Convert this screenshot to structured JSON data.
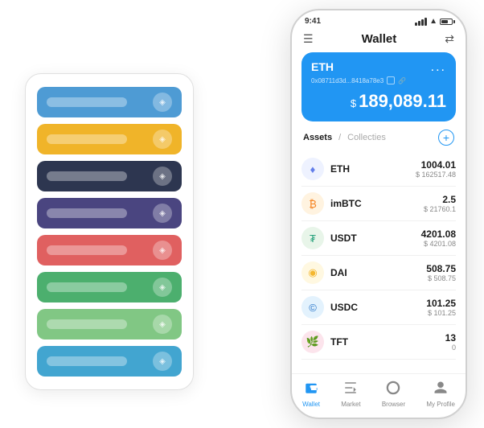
{
  "page": {
    "background": "#ffffff"
  },
  "status_bar": {
    "time": "9:41",
    "battery_label": "battery"
  },
  "header": {
    "menu_icon": "☰",
    "title": "Wallet",
    "scan_icon": "⇄"
  },
  "eth_card": {
    "label": "ETH",
    "address": "0x08711d3d...8418a78e3",
    "copy_hint": "copy",
    "dots": "...",
    "balance_symbol": "$",
    "balance": "189,089.11"
  },
  "assets_section": {
    "tab_active": "Assets",
    "divider": "/",
    "tab_inactive": "Collecties",
    "add_icon": "+"
  },
  "assets": [
    {
      "name": "ETH",
      "amount": "1004.01",
      "usd": "$ 162517.48",
      "icon_type": "eth"
    },
    {
      "name": "imBTC",
      "amount": "2.5",
      "usd": "$ 21760.1",
      "icon_type": "imbtc"
    },
    {
      "name": "USDT",
      "amount": "4201.08",
      "usd": "$ 4201.08",
      "icon_type": "usdt"
    },
    {
      "name": "DAI",
      "amount": "508.75",
      "usd": "$ 508.75",
      "icon_type": "dai"
    },
    {
      "name": "USDC",
      "amount": "101.25",
      "usd": "$ 101.25",
      "icon_type": "usdc"
    },
    {
      "name": "TFT",
      "amount": "13",
      "usd": "0",
      "icon_type": "tft"
    }
  ],
  "nav": [
    {
      "icon": "👛",
      "label": "Wallet",
      "active": true
    },
    {
      "icon": "📊",
      "label": "Market",
      "active": false
    },
    {
      "icon": "🌐",
      "label": "Browser",
      "active": false
    },
    {
      "icon": "👤",
      "label": "My Profile",
      "active": false
    }
  ],
  "card_stack": {
    "cards": [
      {
        "color": "#4e9bd4",
        "label": ""
      },
      {
        "color": "#f0b429",
        "label": ""
      },
      {
        "color": "#2d3650",
        "label": ""
      },
      {
        "color": "#4a4580",
        "label": ""
      },
      {
        "color": "#e06060",
        "label": ""
      },
      {
        "color": "#4caf6e",
        "label": ""
      },
      {
        "color": "#81c784",
        "label": ""
      },
      {
        "color": "#42a5d0",
        "label": ""
      }
    ]
  }
}
